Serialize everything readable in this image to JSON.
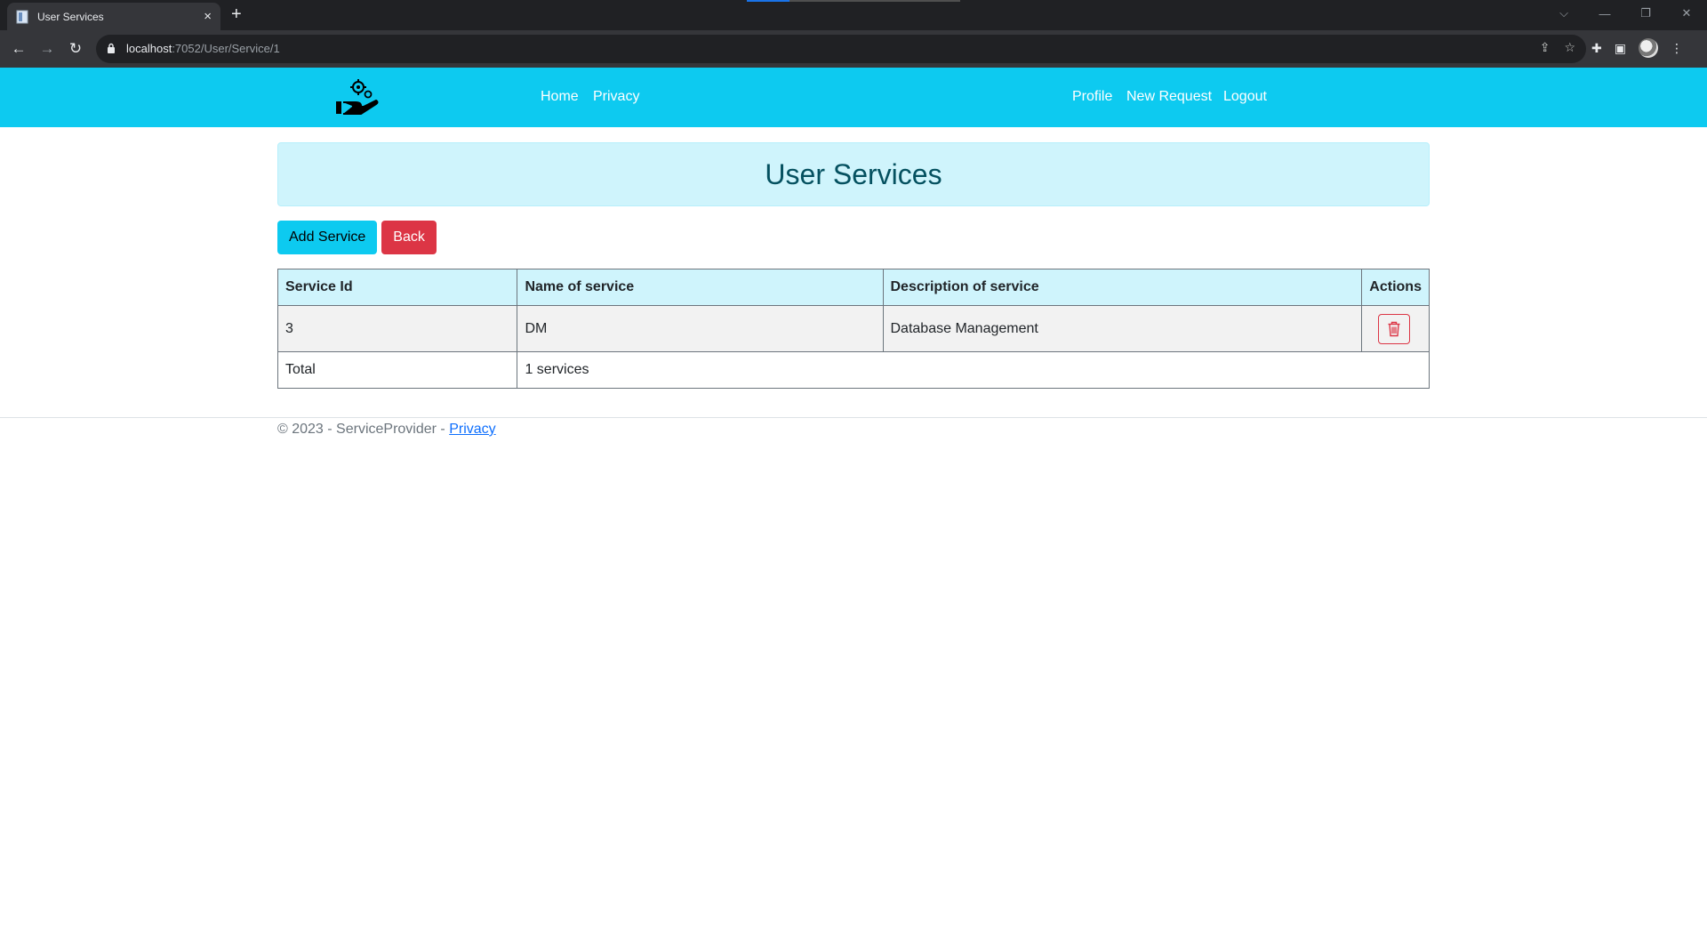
{
  "browser": {
    "tab_title": "User Services",
    "new_tab": "+",
    "close_tab": "×",
    "url_host": "localhost",
    "url_rest": ":7052/User/Service/1",
    "window_controls": [
      "⌵",
      "—",
      "❐",
      "✕"
    ],
    "nav": {
      "back": "←",
      "forward": "→",
      "reload": "↻"
    }
  },
  "navbar": {
    "brand_icon": "hand-gears-logo-icon",
    "links_left": [
      "Home",
      "Privacy"
    ],
    "links_right": [
      "Profile",
      "New Request",
      "Logout"
    ],
    "color": "#0dcaf0"
  },
  "page": {
    "title": "User Services",
    "buttons": {
      "add": "Add Service",
      "back": "Back"
    }
  },
  "table": {
    "headers": [
      "Service Id",
      "Name of service",
      "Description of service",
      "Actions"
    ],
    "rows": [
      {
        "id": "3",
        "name": "DM",
        "description": "Database Management",
        "action_icon": "trash-icon"
      }
    ],
    "total_label": "Total",
    "total_value": "1 services"
  },
  "footer": {
    "text": "© 2023 - ServiceProvider - ",
    "link": "Privacy"
  }
}
